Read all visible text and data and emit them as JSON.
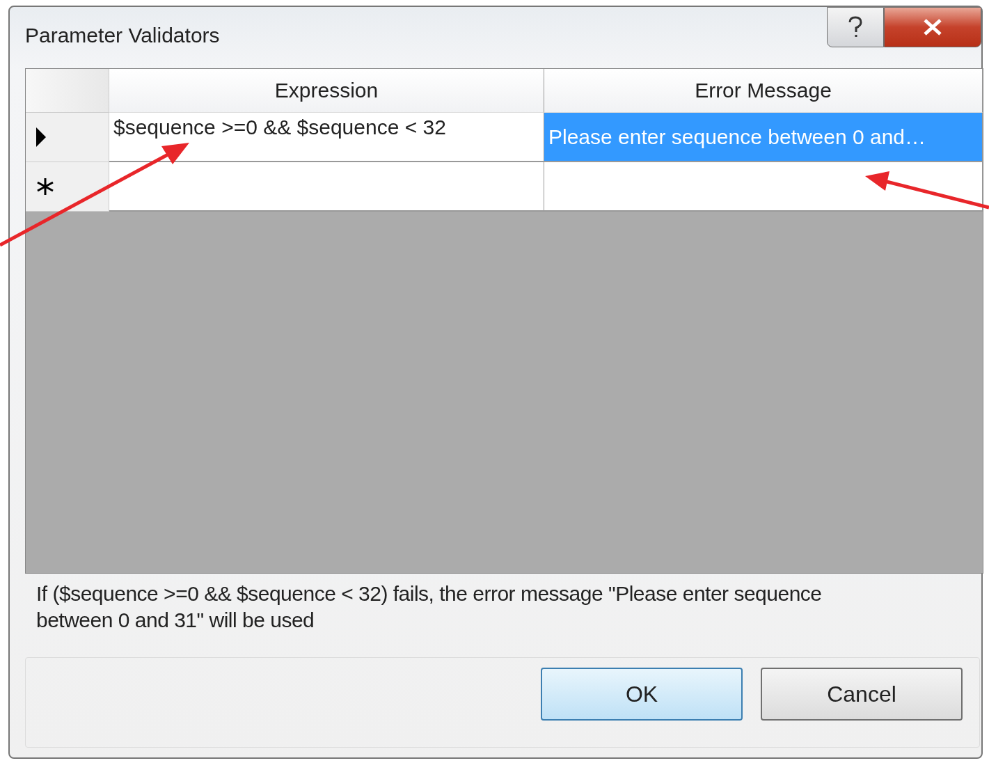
{
  "window": {
    "title": "Parameter Validators"
  },
  "grid": {
    "columns": [
      "Expression",
      "Error Message"
    ],
    "rows": [
      {
        "kind": "current",
        "cells": [
          {
            "text": "$sequence >=0 && $sequence < 32",
            "selected": false
          },
          {
            "text": "Please enter sequence between 0 and…",
            "selected": true
          }
        ]
      },
      {
        "kind": "new",
        "cells": [
          {
            "text": "",
            "selected": false
          },
          {
            "text": "",
            "selected": false
          }
        ]
      }
    ]
  },
  "description": "If ($sequence >=0 && $sequence < 32) fails, the error message \"Please enter sequence between 0 and 31\" will be used",
  "buttons": [
    {
      "label": "OK",
      "default": true
    },
    {
      "label": "Cancel",
      "default": false
    }
  ]
}
